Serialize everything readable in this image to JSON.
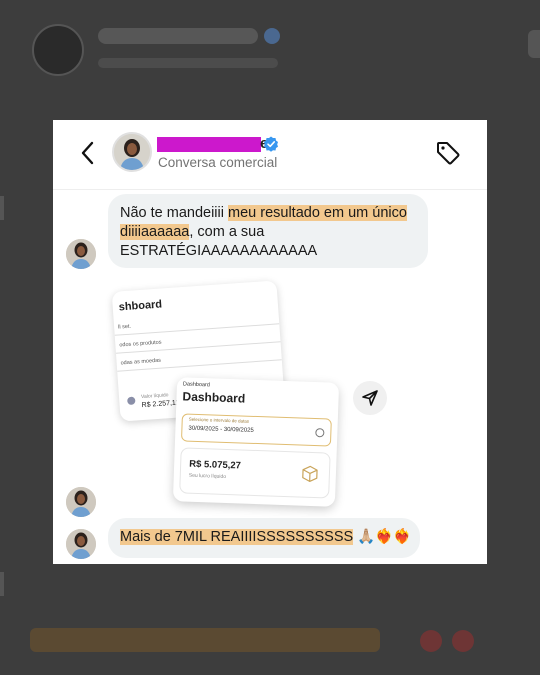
{
  "header": {
    "name_tail": "e",
    "subtitle": "Conversa comercial"
  },
  "messages": {
    "first": {
      "part1": "Não te mandeiiii",
      "highlight1": "meu resultado em um único",
      "highlight2": "diiiiaaaaaa",
      "part2": ", com a sua",
      "part3": "ESTRATÉGIAAAAAAAAAAAA"
    },
    "second": {
      "highlight": "Mais de 7MIL REAIIIISSSSSSSSSS",
      "emojis": "🙏🏼❤️‍🔥❤️‍🔥"
    }
  },
  "screenshot_back": {
    "title": "shboard",
    "rows": [
      "ll set.",
      "odos os produtos",
      "odas as moedas"
    ],
    "value_label": "Valor líquido",
    "value": "R$ 2.257,12"
  },
  "screenshot_front": {
    "kicker": "Dashboard",
    "title": "Dashboard",
    "select_label": "Selecione o intervalo de datas",
    "date_range": "30/09/2025 - 30/09/2025",
    "profit_value": "R$ 5.075,27",
    "profit_label": "Seu lucro líquido"
  },
  "icons": {
    "back": "chevron-left-icon",
    "verified": "verified-badge-icon",
    "tag": "tag-icon",
    "share": "send-icon",
    "box": "box-icon"
  },
  "colors": {
    "highlight": "#f2c88e",
    "redaction": "#cc18cc",
    "verified": "#3897f0",
    "bubble": "#eff2f3"
  }
}
